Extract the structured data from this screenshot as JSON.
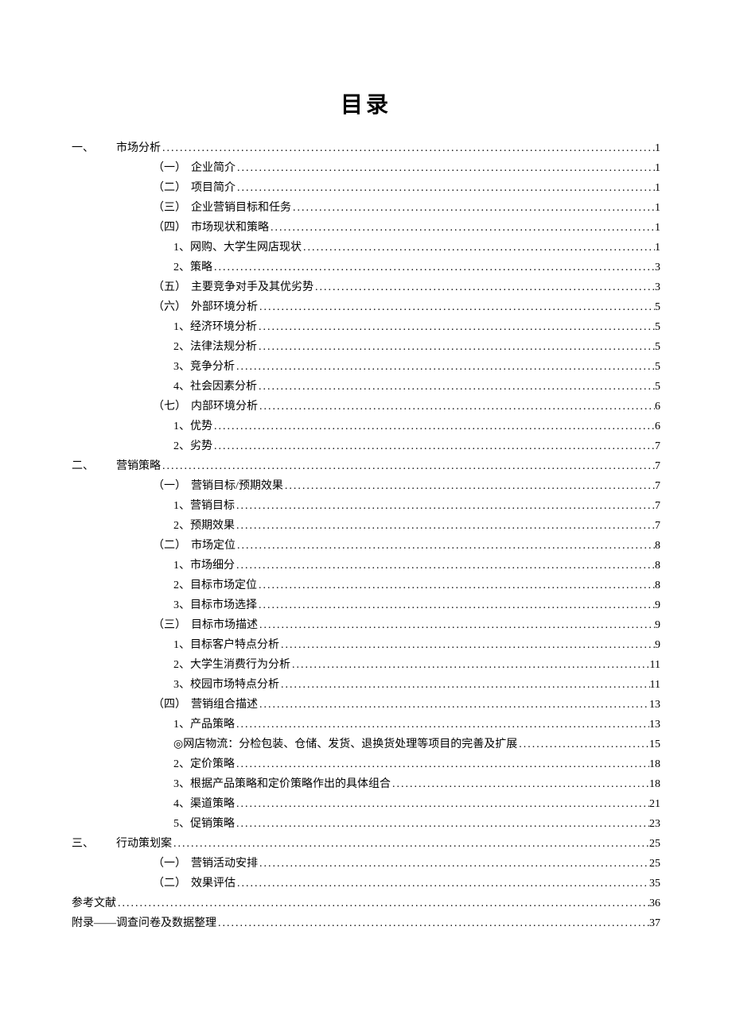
{
  "title": "目录",
  "entries": [
    {
      "level": 1,
      "prefix": "一、",
      "text": "市场分析",
      "page": "1"
    },
    {
      "level": 2,
      "prefix": "（一）",
      "text": "企业简介",
      "page": "1"
    },
    {
      "level": 2,
      "prefix": "（二）",
      "text": "项目简介",
      "page": "1"
    },
    {
      "level": 2,
      "prefix": "（三）",
      "text": "企业营销目标和任务",
      "page": "1"
    },
    {
      "level": 2,
      "prefix": "（四）",
      "text": "市场现状和策略",
      "page": "1"
    },
    {
      "level": 3,
      "prefix": "1、",
      "text": "网购、大学生网店现状",
      "page": "1"
    },
    {
      "level": 3,
      "prefix": "2、",
      "text": "策略",
      "page": "3"
    },
    {
      "level": 2,
      "prefix": "（五）",
      "text": "主要竞争对手及其优劣势",
      "page": "3"
    },
    {
      "level": 2,
      "prefix": "（六）",
      "text": "外部环境分析",
      "page": "5"
    },
    {
      "level": 3,
      "prefix": "1、",
      "text": "经济环境分析",
      "page": "5"
    },
    {
      "level": 3,
      "prefix": "2、",
      "text": "法律法规分析",
      "page": "5"
    },
    {
      "level": 3,
      "prefix": "3、",
      "text": "竞争分析",
      "page": "5"
    },
    {
      "level": 3,
      "prefix": "4、",
      "text": "社会因素分析",
      "page": "5"
    },
    {
      "level": 2,
      "prefix": "（七）",
      "text": "内部环境分析",
      "page": "6"
    },
    {
      "level": 3,
      "prefix": "1、",
      "text": "优势",
      "page": "6"
    },
    {
      "level": 3,
      "prefix": "2、",
      "text": "劣势",
      "page": "7"
    },
    {
      "level": 1,
      "prefix": "二、",
      "text": "营销策略",
      "page": "7"
    },
    {
      "level": 2,
      "prefix": "（一）",
      "text": "营销目标/预期效果",
      "page": "7"
    },
    {
      "level": 3,
      "prefix": "1、",
      "text": "营销目标",
      "page": "7"
    },
    {
      "level": 3,
      "prefix": "2、",
      "text": "预期效果",
      "page": "7"
    },
    {
      "level": 2,
      "prefix": "（二）",
      "text": "市场定位",
      "page": "8"
    },
    {
      "level": 3,
      "prefix": "1、",
      "text": "市场细分",
      "page": "8"
    },
    {
      "level": 3,
      "prefix": "2、",
      "text": "目标市场定位",
      "page": "8"
    },
    {
      "level": 3,
      "prefix": "3、",
      "text": "目标市场选择",
      "page": "9"
    },
    {
      "level": 2,
      "prefix": "（三）",
      "text": "目标市场描述",
      "page": "9"
    },
    {
      "level": 3,
      "prefix": "1、",
      "text": "目标客户特点分析",
      "page": "9"
    },
    {
      "level": 3,
      "prefix": "2、",
      "text": "大学生消费行为分析",
      "page": "11"
    },
    {
      "level": 3,
      "prefix": "3、",
      "text": "校园市场特点分析",
      "page": "11"
    },
    {
      "level": 2,
      "prefix": "（四）",
      "text": "营销组合描述",
      "page": "13"
    },
    {
      "level": 3,
      "prefix": "1、",
      "text": "产品策略",
      "page": "13"
    },
    {
      "level": 3,
      "prefix": "◎ ",
      "text": "网店物流：分检包装、仓储、发货、退换货处理等项目的完善及扩展",
      "page": "15"
    },
    {
      "level": 3,
      "prefix": "2、",
      "text": "定价策略",
      "page": "18"
    },
    {
      "level": 3,
      "prefix": "3、",
      "text": "根据产品策略和定价策略作出的具体组合",
      "page": "18"
    },
    {
      "level": 3,
      "prefix": "4、",
      "text": "渠道策略",
      "page": "21"
    },
    {
      "level": 3,
      "prefix": "5、",
      "text": "促销策略",
      "page": "23"
    },
    {
      "level": 1,
      "prefix": "三、",
      "text": "行动策划案",
      "page": "25"
    },
    {
      "level": 2,
      "prefix": "（一）",
      "text": "营销活动安排",
      "page": "25"
    },
    {
      "level": 2,
      "prefix": "（二）",
      "text": "效果评估",
      "page": "35"
    },
    {
      "level": 0,
      "prefix": "",
      "text": "参考文献",
      "page": "36"
    },
    {
      "level": 0,
      "prefix": "",
      "text": "附录——调查问卷及数据整理",
      "page": "37"
    }
  ]
}
